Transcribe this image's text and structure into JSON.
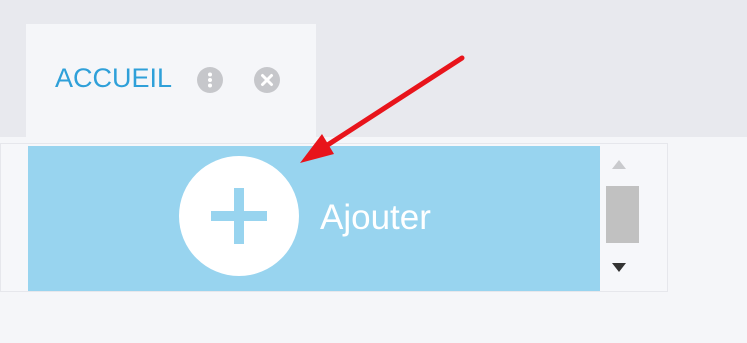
{
  "tab": {
    "label": "ACCUEIL",
    "menu_icon": "more-vertical-icon",
    "close_icon": "close-icon"
  },
  "panel": {
    "add_label": "Ajouter",
    "add_icon": "plus-icon"
  },
  "scrollbar": {
    "up_icon": "scroll-up-arrow-icon",
    "down_icon": "scroll-down-arrow-icon"
  },
  "annotation": {
    "arrow_icon": "red-arrow-icon"
  },
  "colors": {
    "tab_text": "#2fa0d9",
    "add_button_bg": "#98d4ef",
    "arrow": "#e8141b"
  }
}
